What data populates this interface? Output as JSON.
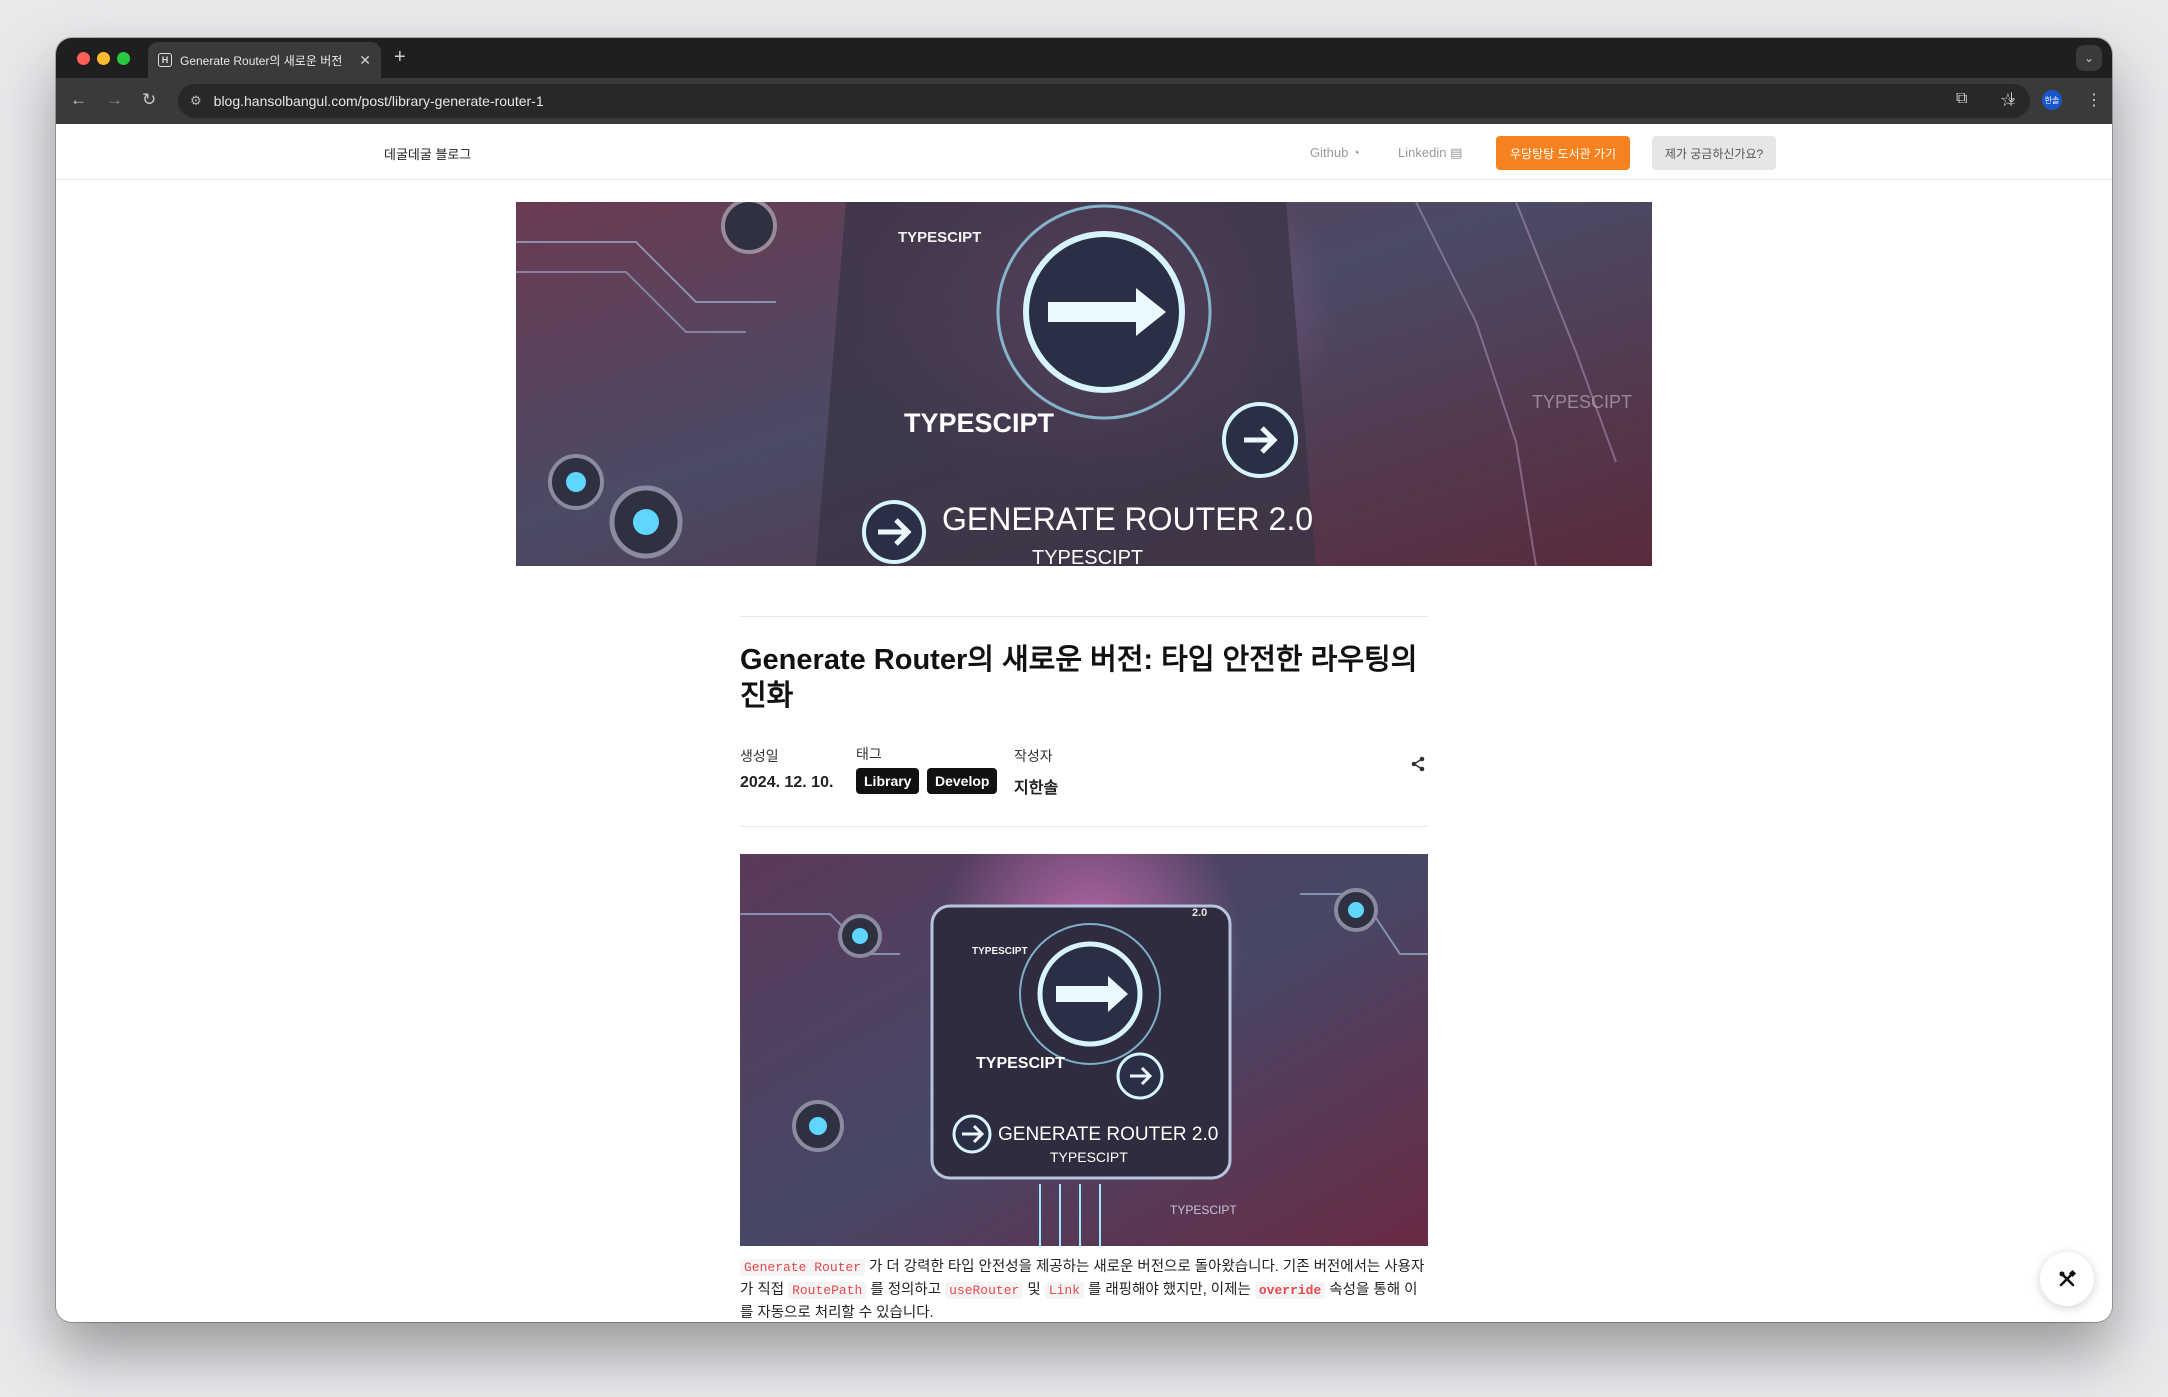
{
  "browser": {
    "tab_title": "Generate Router의 새로운 버전",
    "favicon_letter": "H",
    "url": "blog.hansolbangul.com/post/library-generate-router-1",
    "profile_initials": "한솔"
  },
  "site": {
    "brand": "데굴데굴 블로그",
    "nav": {
      "github": "Github",
      "linkedin": "Linkedin",
      "library_button": "우당탕탕 도서관 가기",
      "question_button": "제가 궁금하신가요?"
    }
  },
  "hero_image": {
    "texts": [
      "TYPESCIPT",
      "TYPESCIPT",
      "GENERATE ROUTER 2.0",
      "TYPESCIPT",
      "TYPESCIPT"
    ]
  },
  "post": {
    "title": "Generate Router의 새로운 버전: 타입 안전한 라우팅의 진화",
    "meta": {
      "created_label": "생성일",
      "created_value": "2024. 12. 10.",
      "tags_label": "태그",
      "tags": [
        "Library",
        "Develop"
      ],
      "author_label": "작성자",
      "author_value": "지한솔"
    },
    "content_image": {
      "texts": [
        "TYPESCIPT",
        "TYPESCIPT",
        "GENERATE ROUTER 2.0",
        "TYPESCIPT",
        "TYPESCIPT",
        "2.0"
      ]
    },
    "intro": {
      "code1": "Generate Router",
      "text1": " 가 더 강력한 타입 안전성을 제공하는 새로운 버전으로 돌아왔습니다. 기존 버전에서는 사용자가 직접 ",
      "code2": "RoutePath",
      "text2": " 를 정의하고 ",
      "code3": "useRouter",
      "text3": " 및 ",
      "code4": "Link",
      "text4": " 를 래핑해야 했지만, 이제는 ",
      "code5": "override",
      "text5": " 속성을 통해 이를 자동으로 처리할 수 있습니다."
    }
  },
  "colors": {
    "accent_orange": "#f5821f",
    "tag_bg": "#111111",
    "inline_code": "#e5484d"
  }
}
